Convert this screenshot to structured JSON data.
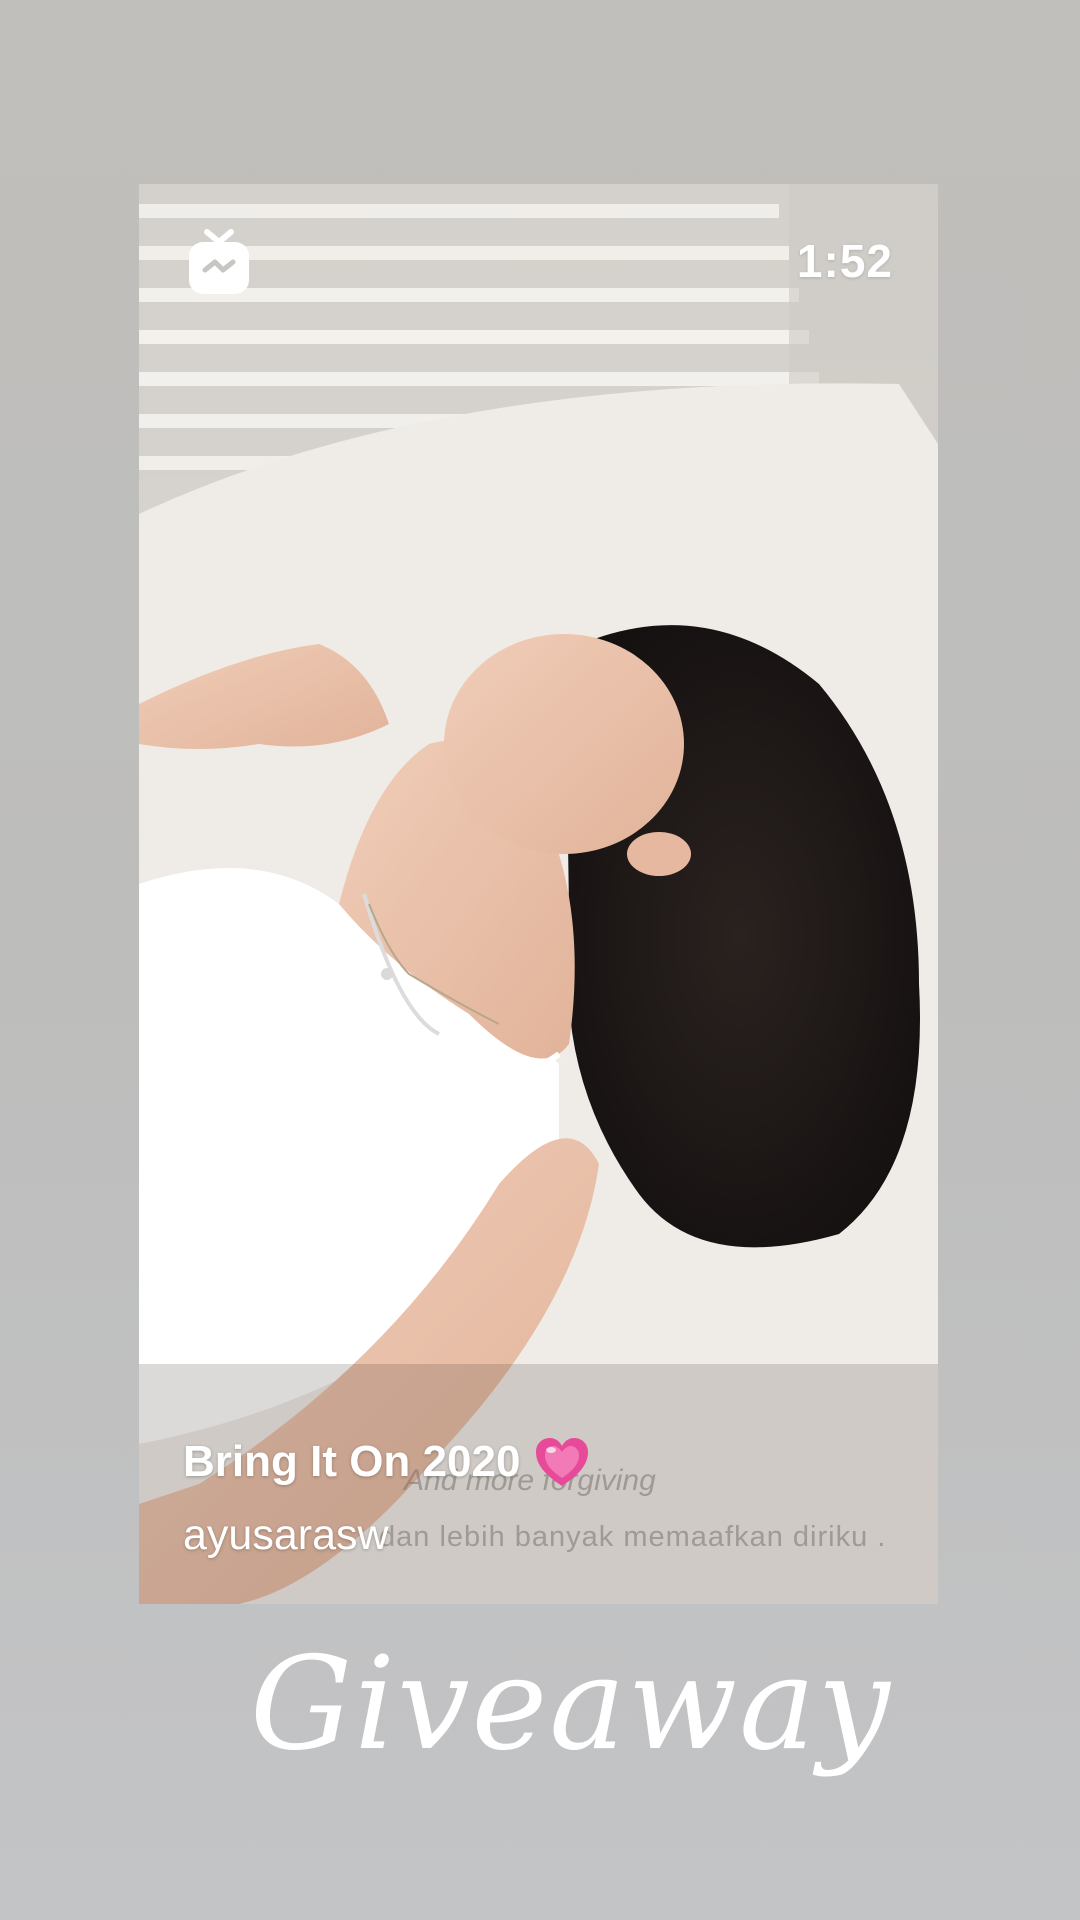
{
  "video": {
    "duration": "1:52",
    "title": "Bring It On 2020",
    "title_emoji": "heart-emoji",
    "channel": "ayusarasw",
    "subtitles": {
      "english": "And more forgiving",
      "indonesian": "dan lebih banyak memaafkan diriku ."
    }
  },
  "icons": {
    "app": "igtv-icon"
  },
  "sticker": {
    "text": "Giveaway"
  },
  "colors": {
    "background": "#c0bfbb",
    "text": "#ffffff",
    "heart": "#e84a9a"
  }
}
